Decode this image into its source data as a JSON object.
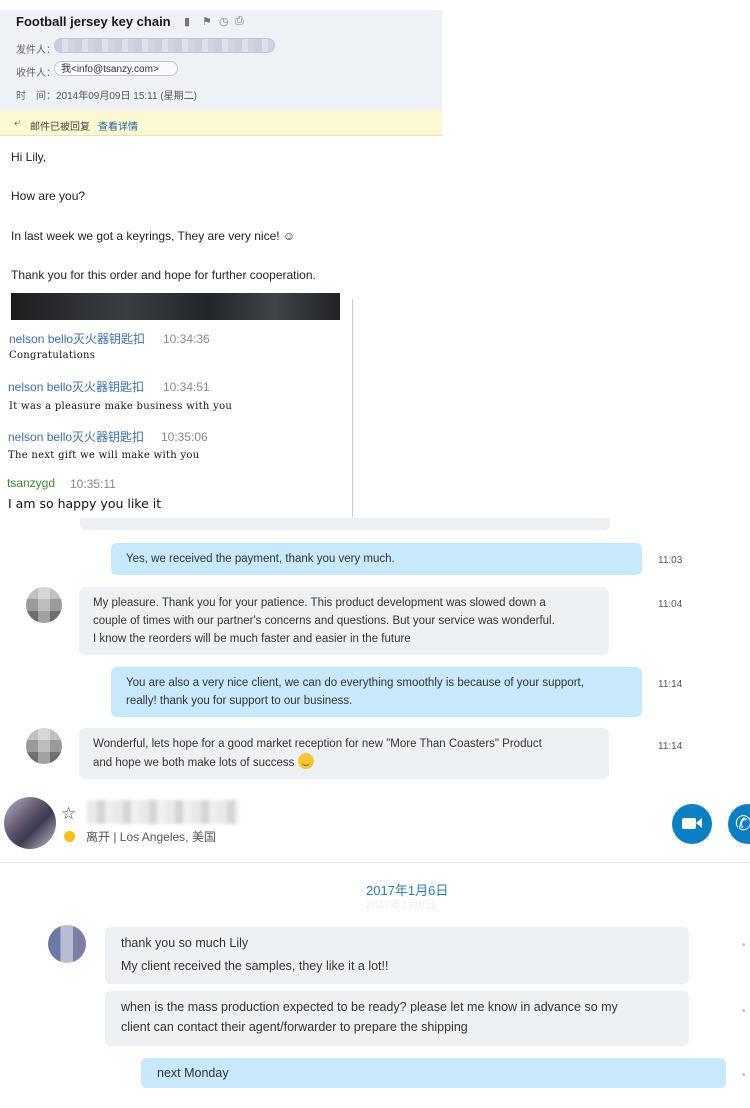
{
  "email": {
    "subject": "Football jersey key chain",
    "header_icons": [
      "bookmark-icon",
      "flag-icon",
      "clock-icon",
      "print-icon"
    ],
    "from_label": "发件人：",
    "to_label": "收件人：",
    "to_value": "我<info@tsanzy.com>",
    "time_label": "时　间：",
    "time_value": "2014年09月09日 15:11 (星期二)",
    "reply_status": "邮件已被回复",
    "reply_detail_link": "查看详情",
    "body": [
      "Hi Lily,",
      "How are you?",
      "In last week we got a keyrings, They are very nice! ☺",
      "Thank you for this order and hope for further cooperation."
    ]
  },
  "qq_chat": [
    {
      "name": "nelson bello灭火器钥匙扣",
      "time": "10:34:36",
      "text": "Congratulations"
    },
    {
      "name": "nelson bello灭火器钥匙扣",
      "time": "10:34:51",
      "text": "It was a pleasure make business with you"
    },
    {
      "name": "nelson bello灭火器钥匙扣",
      "time": "10:35:06",
      "text": "The next gift we will make with you"
    },
    {
      "name": "tsanzygd",
      "time": "10:35:11",
      "text": "I am so happy you like it"
    }
  ],
  "skype_chat_1": {
    "messages": [
      {
        "dir": "out",
        "time": "11:03",
        "lines": [
          "Yes, we received the payment, thank you very much."
        ]
      },
      {
        "dir": "in",
        "time": "11:04",
        "lines": [
          "My pleasure. Thank you for your patience. This product development was slowed down a",
          "couple of times with our partner's concerns and questions. But your service was wonderful.",
          "I know the reorders will be much faster and easier in the future"
        ]
      },
      {
        "dir": "out",
        "time": "11:14",
        "lines": [
          "You are also a very nice client, we can do everything smoothly is because of your support,",
          "really! thank you for support to our business."
        ]
      },
      {
        "dir": "in",
        "time": "11:14",
        "lines": [
          "Wonderful, lets hope for a good market reception for new \"More Than Coasters\" Product",
          "and hope we both make lots of success"
        ]
      }
    ]
  },
  "skype_chat_2": {
    "presence_text": "离开 | Los Angeles, 美国",
    "presence_color": "#f2c218",
    "date_separator": "2017年1月6日",
    "messages": [
      {
        "dir": "in",
        "lines": [
          "thank you so much Lily",
          "My client received the samples, they like it a lot!!"
        ]
      },
      {
        "dir": "in",
        "lines": [
          "when is the mass production expected to be ready? please let me know in advance so my",
          "client can contact their agent/forwarder to prepare the shipping"
        ]
      },
      {
        "dir": "out",
        "lines": [
          "next Monday"
        ]
      }
    ]
  },
  "colors": {
    "outgoing_bubble": "#c7e9fb",
    "incoming_bubble": "#eef1f4",
    "skype_blue": "#0d7fc4",
    "qq_name_blue": "#3a6fb5",
    "qq_self_green": "#3a8a34"
  }
}
